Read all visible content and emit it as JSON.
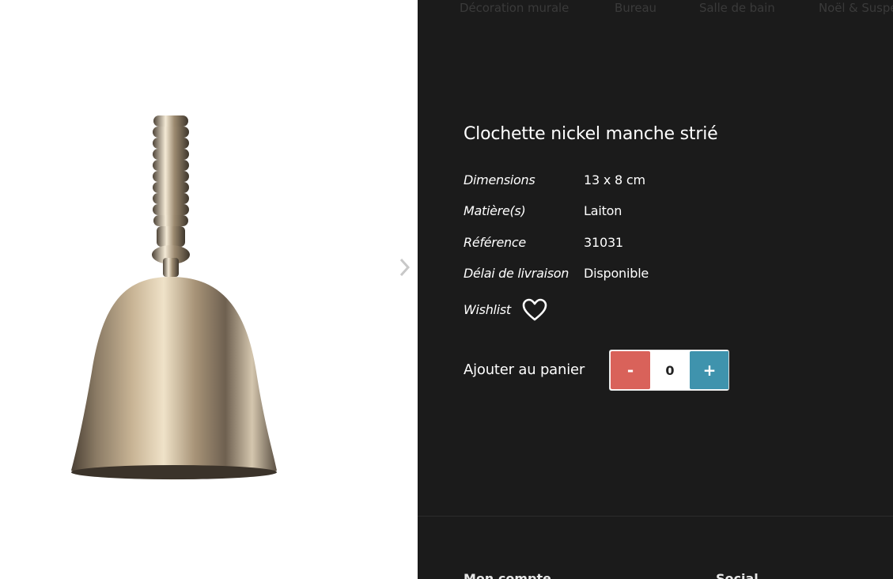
{
  "nav": {
    "items": [
      {
        "label": "Décoration murale"
      },
      {
        "label": "Bureau"
      },
      {
        "label": "Salle de bain"
      },
      {
        "label": "Noël & Suspensions"
      }
    ]
  },
  "product": {
    "title": "Clochette nickel manche strié",
    "specs": [
      {
        "label": "Dimensions",
        "value": "13 x 8 cm"
      },
      {
        "label": "Matière(s)",
        "value": "Laiton"
      },
      {
        "label": "Référence",
        "value": "31031"
      },
      {
        "label": "Délai de livraison",
        "value": "Disponible"
      }
    ],
    "wishlist_label": "Wishlist"
  },
  "cart": {
    "label": "Ajouter au panier",
    "minus": "-",
    "quantity": "0",
    "plus": "+"
  },
  "footer": {
    "headings": [
      "Mon compte",
      "Social"
    ]
  },
  "colors": {
    "panel_bg": "#1b1b1b",
    "minus_button": "#d9625a",
    "plus_button": "#3f93ad"
  }
}
